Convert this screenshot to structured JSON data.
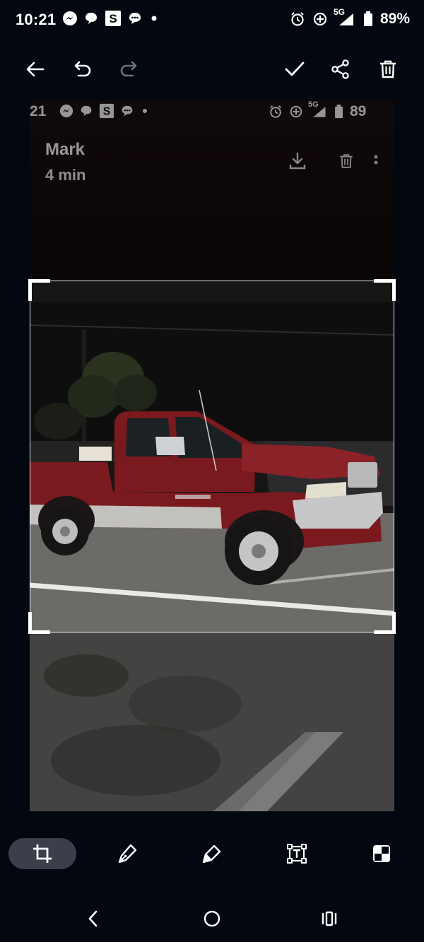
{
  "status_bar": {
    "time": "10:21",
    "battery": "89%",
    "network": "5G",
    "icons": [
      "messenger-icon",
      "chat-bubble-icon",
      "s-app-icon",
      "message-icon",
      "dot-icon",
      "alarm-icon",
      "data-saver-icon",
      "signal-icon",
      "battery-icon"
    ]
  },
  "toolbar": {
    "icons": [
      "back-arrow-icon",
      "undo-icon",
      "redo-icon",
      "check-icon",
      "share-icon",
      "delete-icon"
    ]
  },
  "preview": {
    "status_time": "21",
    "status_battery": "89",
    "status_network": "5G",
    "sender": "Mark",
    "time_ago": "4 min",
    "actions": [
      "download-icon",
      "delete-icon",
      "more-icon"
    ]
  },
  "edit_tools": {
    "items": [
      "crop-icon",
      "pen-icon",
      "highlighter-icon",
      "text-extract-icon",
      "mosaic-icon"
    ],
    "active": "crop-icon"
  },
  "nav_bar": {
    "items": [
      "back-icon",
      "home-icon",
      "recents-icon"
    ]
  },
  "colors": {
    "background": "#03070f",
    "active_tool": "#3a3f4a",
    "truck_red": "#7a1a1e"
  }
}
